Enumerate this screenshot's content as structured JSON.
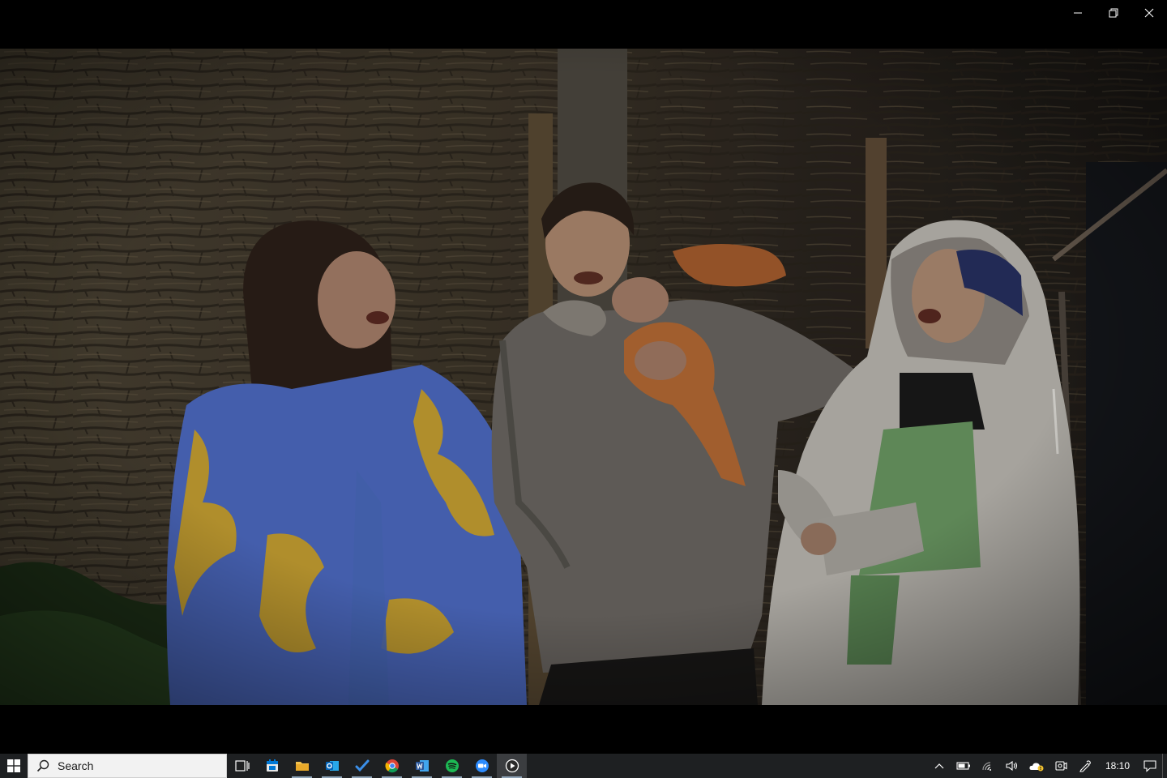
{
  "window": {
    "title": "",
    "controls": [
      "minimize",
      "restore",
      "close"
    ]
  },
  "video": {
    "content": "frame"
  },
  "taskbar": {
    "search_placeholder": "Search",
    "apps": [
      {
        "icon": "task-view-icon"
      },
      {
        "icon": "calendar-store-icon"
      },
      {
        "icon": "file-explorer-icon"
      },
      {
        "icon": "outlook-icon"
      },
      {
        "icon": "todo-icon"
      },
      {
        "icon": "chrome-icon"
      },
      {
        "icon": "word-icon"
      },
      {
        "icon": "spotify-icon"
      },
      {
        "icon": "zoom-icon"
      },
      {
        "icon": "media-player-icon"
      }
    ],
    "clock": "18:10",
    "colors": {
      "taskbar_bg": "#1e2022",
      "accent_blue": "#0078d4",
      "spotify_green": "#1db954",
      "zoom_blue": "#2d8cff",
      "word_blue": "#2b579a"
    }
  }
}
